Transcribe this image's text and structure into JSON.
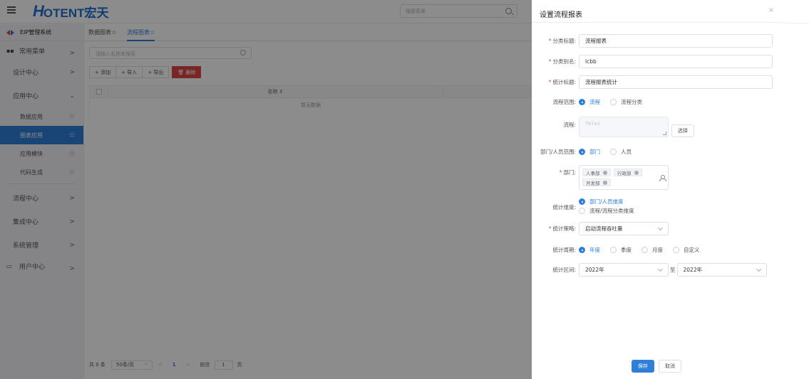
{
  "header": {
    "logo_h": "H",
    "logo_rest": "OTENT宏天",
    "search_placeholder": "搜索菜单"
  },
  "sidebar": {
    "system": "EIP管理系统",
    "items": [
      {
        "label": "常用菜单"
      },
      {
        "label": "设计中心"
      },
      {
        "label": "应用中心"
      },
      {
        "label": "数据应用"
      },
      {
        "label": "图表应用"
      },
      {
        "label": "应用模块"
      },
      {
        "label": "代码生成"
      },
      {
        "label": "流程中心"
      },
      {
        "label": "集成中心"
      },
      {
        "label": "系统管理"
      },
      {
        "label": "用户中心"
      }
    ]
  },
  "main": {
    "tabs": [
      {
        "label": "数据图表☆"
      },
      {
        "label": "流程图表☆"
      }
    ],
    "search_placeholder": "请输入名称来搜索",
    "toolbar": {
      "add": "+ 添加",
      "import": "+ 导入",
      "export": "+ 导出",
      "delete": "🗑 删除"
    },
    "table": {
      "col_name": "名称 ⇕",
      "empty": "暂无数据"
    },
    "pager": {
      "total": "共 0 条",
      "page_size": "50条/页",
      "prev": "<",
      "page": "1",
      "next": ">",
      "goto": "前往",
      "goto_value": "1",
      "page_unit": "页"
    }
  },
  "drawer": {
    "title": "设置流程报表",
    "close": "×",
    "fields": {
      "category_title_label": "分类标题:",
      "category_title_value": "流程报表",
      "category_alias_label": "分类别名:",
      "category_alias_value": "lcbb",
      "stat_title_label": "统计标题:",
      "stat_title_value": "流程报表统计",
      "flow_scope_label": "流程范围:",
      "flow_scope_opt1": "流程",
      "flow_scope_opt2": "流程分类",
      "flow_label": "流程:",
      "flow_value": "fmlei",
      "select_button": "选择",
      "dept_scope_label": "部门/人员范围:",
      "dept_scope_opt1": "部门",
      "dept_scope_opt2": "人员",
      "dept_label": "部门:",
      "dept_tags": [
        "人事部",
        "行政部",
        "开发部"
      ],
      "dimension_label": "统计维度:",
      "dimension_opt1": "部门/人员维度",
      "dimension_opt2": "流程/流程分类维度",
      "strategy_label": "统计策略:",
      "strategy_value": "启动流程吞吐量",
      "period_label": "统计周期:",
      "period_opts": [
        "年度",
        "季度",
        "月度",
        "自定义"
      ],
      "range_label": "统计区间:",
      "range_from": "2022年",
      "range_to_sep": "至",
      "range_to": "2022年"
    },
    "save": "保存",
    "cancel": "取消"
  },
  "colors": {
    "primary": "#2f7fd8",
    "danger": "#e14646",
    "overlay": "rgba(0,0,0,0.45)"
  }
}
